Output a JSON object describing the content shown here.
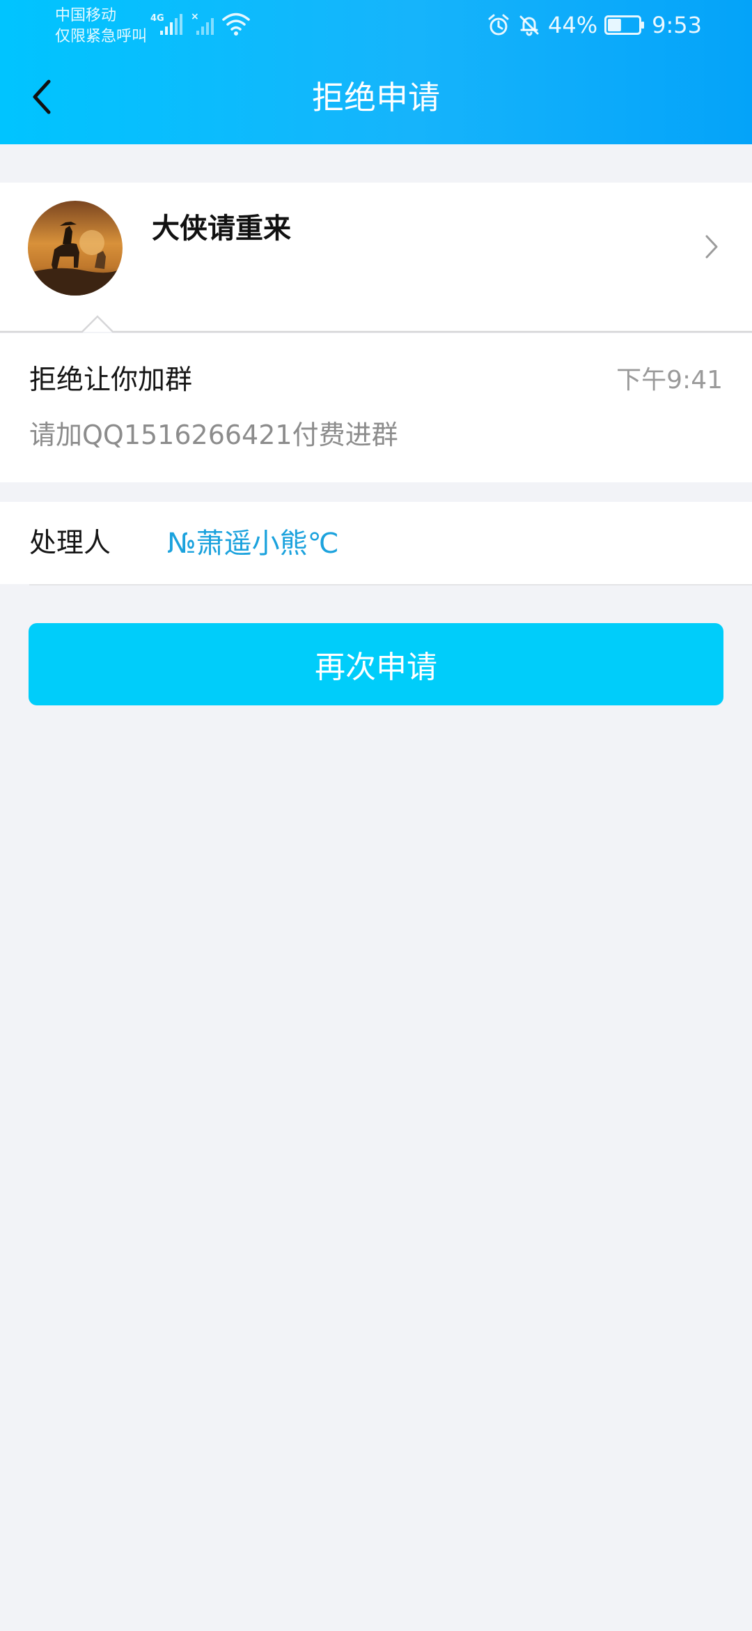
{
  "status_bar": {
    "carrier_line1": "中国移动",
    "carrier_line2": "仅限紧急呼叫",
    "network_type": "4G",
    "battery_percent": "44%",
    "battery_level": 0.44,
    "time": "9:53",
    "icons": [
      "signal-icon",
      "signal-off-icon",
      "wifi-icon",
      "alarm-icon",
      "bell-off-icon",
      "battery-icon"
    ]
  },
  "header": {
    "title": "拒绝申请",
    "back_icon": "back-arrow-icon"
  },
  "requester": {
    "name": "大侠请重来",
    "avatar": "avatar-image",
    "chevron_icon": "chevron-right-icon"
  },
  "message": {
    "title": "拒绝让你加群",
    "time": "下午9:41",
    "body": "请加QQ1516266421付费进群"
  },
  "handler": {
    "label": "处理人",
    "name": "№萧遥小熊℃"
  },
  "actions": {
    "reapply_label": "再次申请"
  },
  "colors": {
    "header_gradient_start": "#00c4ff",
    "header_gradient_end": "#04a3f9",
    "button": "#00cdfa",
    "handler_name": "#1ba2dd",
    "background": "#f2f3f7"
  }
}
